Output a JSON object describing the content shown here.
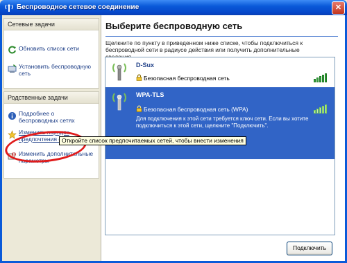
{
  "window": {
    "title": "Беспроводное сетевое соединение",
    "close_label": "✕"
  },
  "sidebar": {
    "network_tasks": {
      "header": "Сетевые задачи",
      "items": [
        {
          "label": "Обновить список сети",
          "icon": "refresh-icon"
        },
        {
          "label": "Установить беспроводную сеть",
          "icon": "setup-wireless-icon"
        }
      ]
    },
    "related_tasks": {
      "header": "Родственные задачи",
      "items": [
        {
          "label": "Подробнее о беспроводных сетях",
          "icon": "info-icon"
        },
        {
          "label": "Изменить порядок предпочтения сетей",
          "icon": "star-icon"
        },
        {
          "label": "Изменить дополнительные параметры",
          "icon": "settings-icon"
        }
      ]
    }
  },
  "main": {
    "heading": "Выберите беспроводную сеть",
    "description": "Щелкните по пункту в приведенном ниже списке, чтобы подключиться к беспроводной сети в радиусе действия или получить дополнительные сведения.",
    "networks": [
      {
        "name": "D-Sux",
        "security": "Безопасная беспроводная сеть",
        "signal_bars": 5,
        "selected": false
      },
      {
        "name": "WPA-TLS",
        "security": "Безопасная беспроводная сеть (WPA)",
        "signal_bars": 5,
        "selected": true,
        "note": "Для подключения к этой сети требуется ключ сети. Если вы хотите подключиться к этой сети, щелкните \"Подключить\"."
      }
    ],
    "connect_button": "Подключить"
  },
  "tooltip": "Откройте список предпочитаемых сетей, чтобы внести изменения",
  "colors": {
    "titlebar": "#0a5ad9",
    "selection": "#3164c6",
    "highlight_circle": "#e01b1b",
    "signal_green": "#33a83a"
  }
}
